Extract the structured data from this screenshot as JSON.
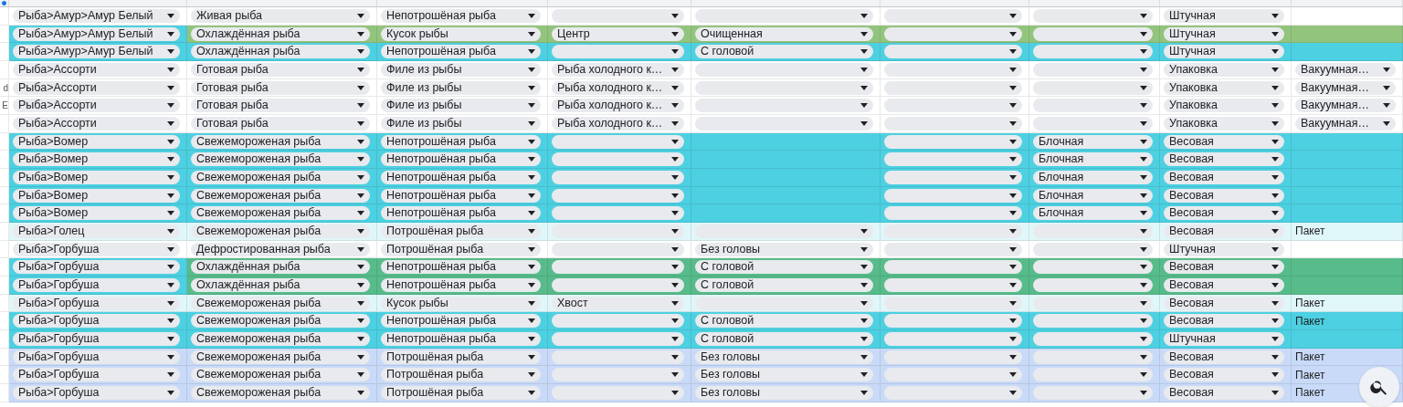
{
  "rows": [
    {
      "color": "#ffffff",
      "cells": [
        {
          "kind": "dropdown",
          "value": "Рыба>Амур>Амур Белый"
        },
        {
          "kind": "dropdown",
          "value": "Живая рыба"
        },
        {
          "kind": "dropdown",
          "value": "Непотрошёная рыба"
        },
        {
          "kind": "dropdown"
        },
        {
          "kind": "dropdown"
        },
        {
          "kind": "dropdown"
        },
        {
          "kind": "dropdown"
        },
        {
          "kind": "dropdown",
          "value": "Штучная"
        },
        {
          "kind": "blank"
        }
      ]
    },
    {
      "color": "#93c47d",
      "cells": [
        {
          "kind": "dropdown",
          "value": "Рыба>Амур>Амур Белый",
          "color": "#4dd0e1"
        },
        {
          "kind": "dropdown",
          "value": "Охлаждённая рыба"
        },
        {
          "kind": "dropdown",
          "value": "Кусок рыбы"
        },
        {
          "kind": "dropdown",
          "value": "Центр"
        },
        {
          "kind": "dropdown",
          "value": "Очищенная"
        },
        {
          "kind": "dropdown"
        },
        {
          "kind": "dropdown"
        },
        {
          "kind": "dropdown",
          "value": "Штучная"
        },
        {
          "kind": "blank"
        }
      ]
    },
    {
      "color": "#4dd0e1",
      "cells": [
        {
          "kind": "dropdown",
          "value": "Рыба>Амур>Амур Белый"
        },
        {
          "kind": "dropdown",
          "value": "Охлаждённая рыба"
        },
        {
          "kind": "dropdown",
          "value": "Непотрошёная рыба"
        },
        {
          "kind": "dropdown"
        },
        {
          "kind": "dropdown",
          "value": "С головой"
        },
        {
          "kind": "dropdown"
        },
        {
          "kind": "dropdown"
        },
        {
          "kind": "dropdown",
          "value": "Штучная"
        },
        {
          "kind": "blank"
        }
      ]
    },
    {
      "color": "#ffffff",
      "cells": [
        {
          "kind": "dropdown",
          "value": "Рыба>Ассорти"
        },
        {
          "kind": "dropdown",
          "value": "Готовая рыба"
        },
        {
          "kind": "dropdown",
          "value": "Филе из рыбы"
        },
        {
          "kind": "dropdown",
          "value": "Рыба холодного к…"
        },
        {
          "kind": "dropdown"
        },
        {
          "kind": "dropdown"
        },
        {
          "kind": "dropdown"
        },
        {
          "kind": "dropdown",
          "value": "Упаковка"
        },
        {
          "kind": "dropdown",
          "value": "Вакуумная…"
        }
      ]
    },
    {
      "color": "#ffffff",
      "edge_text": "d",
      "cells": [
        {
          "kind": "dropdown",
          "value": "Рыба>Ассорти"
        },
        {
          "kind": "dropdown",
          "value": "Готовая рыба"
        },
        {
          "kind": "dropdown",
          "value": "Филе из рыбы"
        },
        {
          "kind": "dropdown",
          "value": "Рыба холодного к…"
        },
        {
          "kind": "dropdown"
        },
        {
          "kind": "dropdown"
        },
        {
          "kind": "dropdown"
        },
        {
          "kind": "dropdown",
          "value": "Упаковка"
        },
        {
          "kind": "dropdown",
          "value": "Вакуумная…"
        }
      ]
    },
    {
      "color": "#ffffff",
      "edge_text": "E",
      "cells": [
        {
          "kind": "dropdown",
          "value": "Рыба>Ассорти"
        },
        {
          "kind": "dropdown",
          "value": "Готовая рыба"
        },
        {
          "kind": "dropdown",
          "value": "Филе из рыбы"
        },
        {
          "kind": "dropdown",
          "value": "Рыба холодного к…"
        },
        {
          "kind": "dropdown"
        },
        {
          "kind": "dropdown"
        },
        {
          "kind": "dropdown"
        },
        {
          "kind": "dropdown",
          "value": "Упаковка"
        },
        {
          "kind": "dropdown",
          "value": "Вакуумная…"
        }
      ]
    },
    {
      "color": "#ffffff",
      "cells": [
        {
          "kind": "dropdown",
          "value": "Рыба>Ассорти"
        },
        {
          "kind": "dropdown",
          "value": "Готовая рыба"
        },
        {
          "kind": "dropdown",
          "value": "Филе из рыбы"
        },
        {
          "kind": "dropdown",
          "value": "Рыба холодного к…"
        },
        {
          "kind": "dropdown"
        },
        {
          "kind": "dropdown"
        },
        {
          "kind": "dropdown"
        },
        {
          "kind": "dropdown",
          "value": "Упаковка"
        },
        {
          "kind": "dropdown",
          "value": "Вакуумная…"
        }
      ]
    },
    {
      "color": "#4dd0e1",
      "cells": [
        {
          "kind": "dropdown",
          "value": "Рыба>Вомер"
        },
        {
          "kind": "dropdown",
          "value": "Свежемороженая рыба"
        },
        {
          "kind": "dropdown",
          "value": "Непотрошёная рыба"
        },
        {
          "kind": "dropdown"
        },
        {
          "kind": "blank"
        },
        {
          "kind": "dropdown"
        },
        {
          "kind": "dropdown",
          "value": "Блочная"
        },
        {
          "kind": "dropdown",
          "value": "Весовая"
        },
        {
          "kind": "blank"
        }
      ]
    },
    {
      "color": "#4dd0e1",
      "cells": [
        {
          "kind": "dropdown",
          "value": "Рыба>Вомер"
        },
        {
          "kind": "dropdown",
          "value": "Свежемороженая рыба"
        },
        {
          "kind": "dropdown",
          "value": "Непотрошёная рыба"
        },
        {
          "kind": "dropdown"
        },
        {
          "kind": "blank"
        },
        {
          "kind": "dropdown"
        },
        {
          "kind": "dropdown",
          "value": "Блочная"
        },
        {
          "kind": "dropdown",
          "value": "Весовая"
        },
        {
          "kind": "blank"
        }
      ]
    },
    {
      "color": "#4dd0e1",
      "cells": [
        {
          "kind": "dropdown",
          "value": "Рыба>Вомер"
        },
        {
          "kind": "dropdown",
          "value": "Свежемороженая рыба"
        },
        {
          "kind": "dropdown",
          "value": "Непотрошёная рыба"
        },
        {
          "kind": "dropdown"
        },
        {
          "kind": "blank"
        },
        {
          "kind": "dropdown"
        },
        {
          "kind": "dropdown",
          "value": "Блочная"
        },
        {
          "kind": "dropdown",
          "value": "Весовая"
        },
        {
          "kind": "blank"
        }
      ]
    },
    {
      "color": "#4dd0e1",
      "cells": [
        {
          "kind": "dropdown",
          "value": "Рыба>Вомер"
        },
        {
          "kind": "dropdown",
          "value": "Свежемороженая рыба"
        },
        {
          "kind": "dropdown",
          "value": "Непотрошёная рыба"
        },
        {
          "kind": "dropdown"
        },
        {
          "kind": "blank"
        },
        {
          "kind": "dropdown"
        },
        {
          "kind": "dropdown",
          "value": "Блочная"
        },
        {
          "kind": "dropdown",
          "value": "Весовая"
        },
        {
          "kind": "blank"
        }
      ]
    },
    {
      "color": "#4dd0e1",
      "cells": [
        {
          "kind": "dropdown",
          "value": "Рыба>Вомер"
        },
        {
          "kind": "dropdown",
          "value": "Свежемороженая рыба"
        },
        {
          "kind": "dropdown",
          "value": "Непотрошёная рыба"
        },
        {
          "kind": "dropdown"
        },
        {
          "kind": "blank"
        },
        {
          "kind": "dropdown"
        },
        {
          "kind": "dropdown",
          "value": "Блочная"
        },
        {
          "kind": "dropdown",
          "value": "Весовая"
        },
        {
          "kind": "blank"
        }
      ]
    },
    {
      "color": "#e0f7fa",
      "cells": [
        {
          "kind": "dropdown",
          "value": "Рыба>Голец"
        },
        {
          "kind": "dropdown",
          "value": "Свежемороженая рыба"
        },
        {
          "kind": "dropdown",
          "value": "Потрошёная рыба"
        },
        {
          "kind": "dropdown"
        },
        {
          "kind": "dropdown"
        },
        {
          "kind": "dropdown"
        },
        {
          "kind": "dropdown"
        },
        {
          "kind": "dropdown",
          "value": "Весовая"
        },
        {
          "kind": "text",
          "value": "Пакет"
        }
      ]
    },
    {
      "color": "#ffffff",
      "cells": [
        {
          "kind": "dropdown",
          "value": "Рыба>Горбуша"
        },
        {
          "kind": "dropdown",
          "value": "Дефростированная рыба"
        },
        {
          "kind": "dropdown",
          "value": "Потрошёная рыба"
        },
        {
          "kind": "dropdown"
        },
        {
          "kind": "dropdown",
          "value": "Без головы"
        },
        {
          "kind": "dropdown"
        },
        {
          "kind": "dropdown"
        },
        {
          "kind": "dropdown",
          "value": "Штучная"
        },
        {
          "kind": "blank"
        }
      ]
    },
    {
      "color": "#57bb8a",
      "cells": [
        {
          "kind": "dropdown",
          "value": "Рыба>Горбуша",
          "color": "#4dd0e1"
        },
        {
          "kind": "dropdown",
          "value": "Охлаждённая рыба"
        },
        {
          "kind": "dropdown",
          "value": "Непотрошёная рыба"
        },
        {
          "kind": "dropdown"
        },
        {
          "kind": "dropdown",
          "value": "С головой"
        },
        {
          "kind": "dropdown"
        },
        {
          "kind": "dropdown"
        },
        {
          "kind": "dropdown",
          "value": "Весовая"
        },
        {
          "kind": "blank"
        }
      ]
    },
    {
      "color": "#57bb8a",
      "cells": [
        {
          "kind": "dropdown",
          "value": "Рыба>Горбуша",
          "color": "#4dd0e1"
        },
        {
          "kind": "dropdown",
          "value": "Охлаждённая рыба"
        },
        {
          "kind": "dropdown",
          "value": "Непотрошёная рыба"
        },
        {
          "kind": "dropdown"
        },
        {
          "kind": "dropdown",
          "value": "С головой"
        },
        {
          "kind": "dropdown"
        },
        {
          "kind": "dropdown"
        },
        {
          "kind": "dropdown",
          "value": "Весовая"
        },
        {
          "kind": "blank"
        }
      ]
    },
    {
      "color": "#e0f7fa",
      "cells": [
        {
          "kind": "dropdown",
          "value": "Рыба>Горбуша"
        },
        {
          "kind": "dropdown",
          "value": "Свежемороженая рыба"
        },
        {
          "kind": "dropdown",
          "value": "Кусок рыбы"
        },
        {
          "kind": "dropdown",
          "value": "Хвост"
        },
        {
          "kind": "dropdown"
        },
        {
          "kind": "dropdown"
        },
        {
          "kind": "dropdown"
        },
        {
          "kind": "dropdown",
          "value": "Весовая"
        },
        {
          "kind": "text",
          "value": "Пакет"
        }
      ]
    },
    {
      "color": "#4dd0e1",
      "cells": [
        {
          "kind": "dropdown",
          "value": "Рыба>Горбуша"
        },
        {
          "kind": "dropdown",
          "value": "Свежемороженая рыба"
        },
        {
          "kind": "dropdown",
          "value": "Непотрошёная рыба"
        },
        {
          "kind": "dropdown"
        },
        {
          "kind": "dropdown",
          "value": "С головой"
        },
        {
          "kind": "dropdown"
        },
        {
          "kind": "dropdown"
        },
        {
          "kind": "dropdown",
          "value": "Весовая"
        },
        {
          "kind": "text",
          "value": "Пакет"
        }
      ]
    },
    {
      "color": "#4dd0e1",
      "cells": [
        {
          "kind": "dropdown",
          "value": "Рыба>Горбуша"
        },
        {
          "kind": "dropdown",
          "value": "Свежемороженая рыба"
        },
        {
          "kind": "dropdown",
          "value": "Непотрошёная рыба"
        },
        {
          "kind": "dropdown"
        },
        {
          "kind": "dropdown",
          "value": "С головой"
        },
        {
          "kind": "dropdown"
        },
        {
          "kind": "dropdown"
        },
        {
          "kind": "dropdown",
          "value": "Штучная"
        },
        {
          "kind": "blank"
        }
      ]
    },
    {
      "color": "#c9daf8",
      "cells": [
        {
          "kind": "dropdown",
          "value": "Рыба>Горбуша"
        },
        {
          "kind": "dropdown",
          "value": "Свежемороженая рыба"
        },
        {
          "kind": "dropdown",
          "value": "Потрошёная рыба"
        },
        {
          "kind": "dropdown"
        },
        {
          "kind": "dropdown",
          "value": "Без головы"
        },
        {
          "kind": "dropdown"
        },
        {
          "kind": "dropdown"
        },
        {
          "kind": "dropdown",
          "value": "Весовая"
        },
        {
          "kind": "text",
          "value": "Пакет"
        }
      ]
    },
    {
      "color": "#c9daf8",
      "cells": [
        {
          "kind": "dropdown",
          "value": "Рыба>Горбуша"
        },
        {
          "kind": "dropdown",
          "value": "Свежемороженая рыба"
        },
        {
          "kind": "dropdown",
          "value": "Потрошёная рыба"
        },
        {
          "kind": "dropdown"
        },
        {
          "kind": "dropdown",
          "value": "Без головы"
        },
        {
          "kind": "dropdown"
        },
        {
          "kind": "dropdown"
        },
        {
          "kind": "dropdown",
          "value": "Весовая"
        },
        {
          "kind": "text",
          "value": "Пакет"
        }
      ]
    },
    {
      "color": "#c9daf8",
      "cells": [
        {
          "kind": "dropdown",
          "value": "Рыба>Горбуша"
        },
        {
          "kind": "dropdown",
          "value": "Свежемороженая рыба"
        },
        {
          "kind": "dropdown",
          "value": "Потрошёная рыба"
        },
        {
          "kind": "dropdown"
        },
        {
          "kind": "dropdown",
          "value": "Без головы"
        },
        {
          "kind": "dropdown"
        },
        {
          "kind": "dropdown"
        },
        {
          "kind": "dropdown",
          "value": "Весовая"
        },
        {
          "kind": "text",
          "value": "Пакет"
        }
      ]
    }
  ]
}
